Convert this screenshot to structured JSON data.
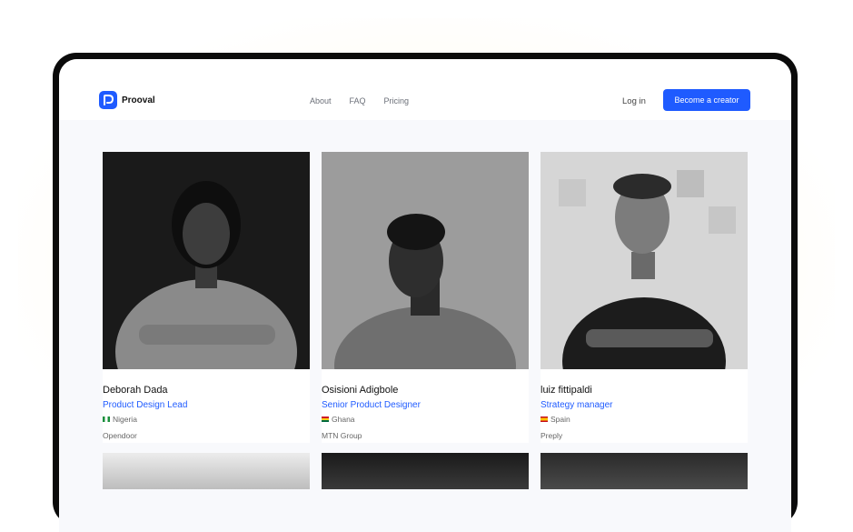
{
  "brand": {
    "name": "Prooval"
  },
  "nav": {
    "links": [
      "About",
      "FAQ",
      "Pricing"
    ],
    "login": "Log in",
    "cta": "Become a creator"
  },
  "creators": [
    {
      "name": "Deborah Dada",
      "role": "Product Design Lead",
      "country": "Nigeria",
      "company": "Opendoor"
    },
    {
      "name": "Osisioni Adigbole",
      "role": "Senior Product Designer",
      "country": "Ghana",
      "company": "MTN Group"
    },
    {
      "name": "luiz fittipaldi",
      "role": "Strategy manager",
      "country": "Spain",
      "company": "Preply"
    }
  ],
  "colors": {
    "accent": "#1f5bff",
    "frame": "#0b0b0b",
    "background": "#f8f9fc"
  }
}
